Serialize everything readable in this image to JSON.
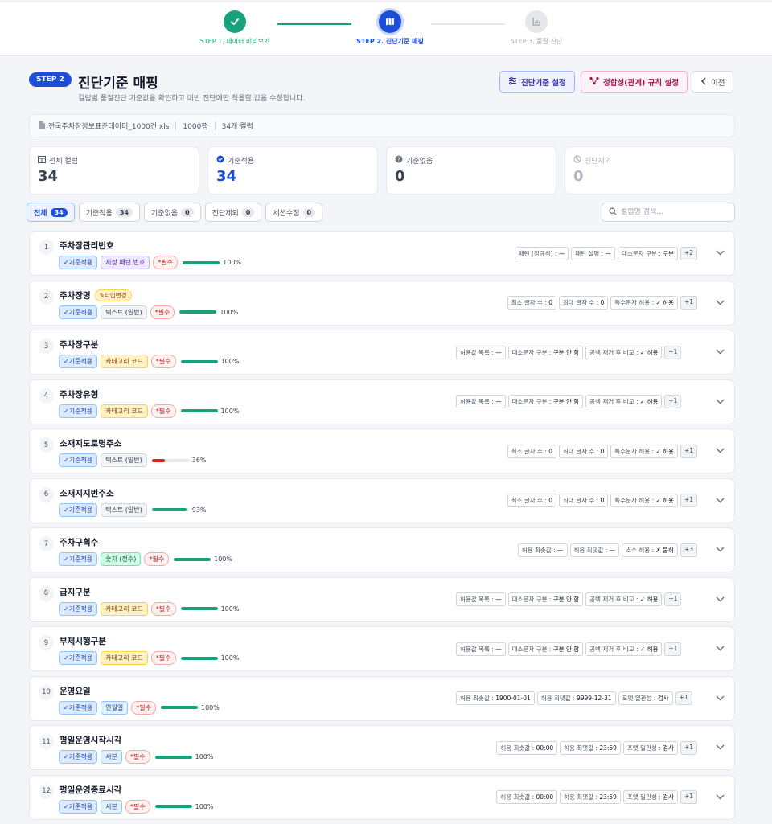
{
  "stepper": {
    "steps": [
      {
        "label": "STEP 1. 데이터 미리보기"
      },
      {
        "label": "STEP 2. 진단기준 매핑"
      },
      {
        "label": "STEP 3. 품질 진단"
      }
    ]
  },
  "header": {
    "step_badge": "STEP 2",
    "title": "진단기준 매핑",
    "subtitle": "컬럼별 품질진단 기준값을 확인하고 이번 진단에만 적용할 값을 수정합니다.",
    "btn_criteria": "진단기준 설정",
    "btn_rules": "정합성(관계) 규칙 설정",
    "btn_prev": "이전"
  },
  "file": {
    "name": "전국주차장정보표준데이터_1000건.xls",
    "rows": "1000행",
    "cols": "34개 컬럼"
  },
  "stats": [
    {
      "label": "전체 컬럼",
      "value": "34",
      "icon": "table-icon"
    },
    {
      "label": "기준적용",
      "value": "34",
      "icon": "check-circle-icon"
    },
    {
      "label": "기준없음",
      "value": "0",
      "icon": "question-circle-icon"
    },
    {
      "label": "진단제외",
      "value": "0",
      "icon": "ban-icon"
    }
  ],
  "filters": [
    {
      "label": "전체",
      "count": "34"
    },
    {
      "label": "기준적용",
      "count": "34"
    },
    {
      "label": "기준없음",
      "count": "0"
    },
    {
      "label": "진단제외",
      "count": "0"
    },
    {
      "label": "세션수정",
      "count": "0"
    }
  ],
  "search": {
    "placeholder": "컬럼명 검색..."
  },
  "labels": {
    "std": "✓기준적용",
    "req": "*필수",
    "type_changed": "타입변경"
  },
  "rows": [
    {
      "num": "1",
      "name": "주차장관리번호",
      "type": "지정 패턴 번호",
      "type_kind": "pattern",
      "required": true,
      "pct": "100%",
      "fill": 1.0,
      "props": [
        [
          "패턴 (정규식)",
          "—"
        ],
        [
          "패턴 설명",
          "—"
        ],
        [
          "대소문자 구분",
          "구분"
        ]
      ],
      "more": "+2"
    },
    {
      "num": "2",
      "name": "주차장명",
      "type_changed": true,
      "type": "텍스트 (일반)",
      "type_kind": "text",
      "required": true,
      "pct": "100%",
      "fill": 1.0,
      "props": [
        [
          "최소 글자 수",
          "0"
        ],
        [
          "최대 글자 수",
          "0"
        ],
        [
          "특수문자 허용",
          "✓ 허용"
        ]
      ],
      "more": "+1"
    },
    {
      "num": "3",
      "name": "주차장구분",
      "type": "카테고리 코드",
      "type_kind": "cat",
      "required": true,
      "pct": "100%",
      "fill": 1.0,
      "props": [
        [
          "허용값 목록",
          "—"
        ],
        [
          "대소문자 구분",
          "구분 안 함"
        ],
        [
          "공백 제거 후 비교",
          "✓ 허용"
        ]
      ],
      "more": "+1",
      "wrap": true
    },
    {
      "num": "4",
      "name": "주차장유형",
      "type": "카테고리 코드",
      "type_kind": "cat",
      "required": true,
      "pct": "100%",
      "fill": 1.0,
      "props": [
        [
          "허용값 목록",
          "—"
        ],
        [
          "대소문자 구분",
          "구분 안 함"
        ],
        [
          "공백 제거 후 비교",
          "✓ 허용"
        ]
      ],
      "more": "+1",
      "wrap": true
    },
    {
      "num": "5",
      "name": "소재지도로명주소",
      "type": "텍스트 (일반)",
      "type_kind": "text",
      "required": false,
      "pct": "36%",
      "fill": 0.36,
      "low": true,
      "props": [
        [
          "최소 글자 수",
          "0"
        ],
        [
          "최대 글자 수",
          "0"
        ],
        [
          "특수문자 허용",
          "✓ 허용"
        ]
      ],
      "more": "+1"
    },
    {
      "num": "6",
      "name": "소재지지번주소",
      "type": "텍스트 (일반)",
      "type_kind": "text",
      "required": false,
      "pct": "93%",
      "fill": 0.93,
      "props": [
        [
          "최소 글자 수",
          "0"
        ],
        [
          "최대 글자 수",
          "0"
        ],
        [
          "특수문자 허용",
          "✓ 허용"
        ]
      ],
      "more": "+1"
    },
    {
      "num": "7",
      "name": "주차구획수",
      "type": "숫자 (정수)",
      "type_kind": "numeric",
      "required": true,
      "pct": "100%",
      "fill": 1.0,
      "props": [
        [
          "허용 최솟값",
          "—"
        ],
        [
          "허용 최댓값",
          "—"
        ],
        [
          "소수 허용",
          "✗ 불허"
        ]
      ],
      "more": "+3"
    },
    {
      "num": "8",
      "name": "급지구분",
      "type": "카테고리 코드",
      "type_kind": "cat",
      "required": true,
      "pct": "100%",
      "fill": 1.0,
      "props": [
        [
          "허용값 목록",
          "—"
        ],
        [
          "대소문자 구분",
          "구분 안 함"
        ],
        [
          "공백 제거 후 비교",
          "✓ 허용"
        ]
      ],
      "more": "+1",
      "wrap": true
    },
    {
      "num": "9",
      "name": "부제시행구분",
      "type": "카테고리 코드",
      "type_kind": "cat",
      "required": true,
      "pct": "100%",
      "fill": 1.0,
      "props": [
        [
          "허용값 목록",
          "—"
        ],
        [
          "대소문자 구분",
          "구분 안 함"
        ],
        [
          "공백 제거 후 비교",
          "✓ 허용"
        ]
      ],
      "more": "+1",
      "wrap": true
    },
    {
      "num": "10",
      "name": "운영요일",
      "type": "연월일",
      "type_kind": "date",
      "required": true,
      "pct": "100%",
      "fill": 1.0,
      "props": [
        [
          "허용 최솟값",
          "1900-01-01"
        ],
        [
          "허용 최댓값",
          "9999-12-31"
        ],
        [
          "포맷 일관성",
          "검사"
        ]
      ],
      "more": "+1",
      "wrap": true
    },
    {
      "num": "11",
      "name": "평일운영시작시각",
      "type": "시분",
      "type_kind": "date",
      "required": true,
      "pct": "100%",
      "fill": 1.0,
      "props": [
        [
          "허용 최솟값",
          "00:00"
        ],
        [
          "허용 최댓값",
          "23:59"
        ],
        [
          "포맷 일관성",
          "검사"
        ]
      ],
      "more": "+1"
    },
    {
      "num": "12",
      "name": "평일운영종료시각",
      "type": "시분",
      "type_kind": "date",
      "required": true,
      "pct": "100%",
      "fill": 1.0,
      "props": [
        [
          "허용 최솟값",
          "00:00"
        ],
        [
          "허용 최댓값",
          "23:59"
        ],
        [
          "포맷 일관성",
          "검사"
        ]
      ],
      "more": "+1"
    }
  ]
}
